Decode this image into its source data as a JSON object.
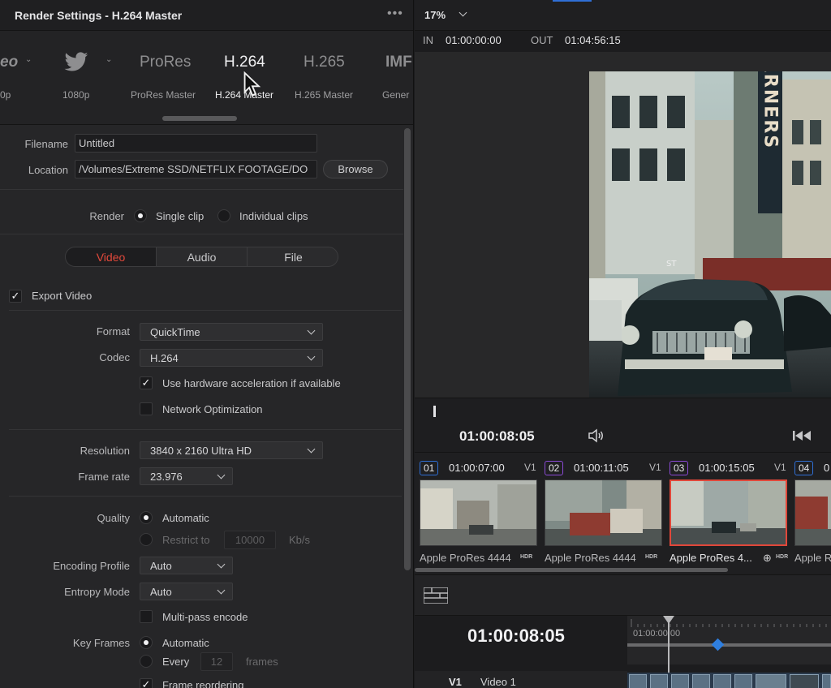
{
  "render_panel": {
    "title": "Render Settings - H.264 Master",
    "menu": "•••",
    "presets": [
      {
        "big": "eo",
        "sub": "0p"
      },
      {
        "big": "",
        "sub": "1080p",
        "icon": "twitter-icon"
      },
      {
        "big": "ProRes",
        "sub": "ProRes Master"
      },
      {
        "big": "H.264",
        "sub": "H.264 Master",
        "active": true
      },
      {
        "big": "H.265",
        "sub": "H.265 Master"
      },
      {
        "big": "IMF",
        "sub": "Gener"
      }
    ],
    "filename_label": "Filename",
    "filename_value": "Untitled",
    "location_label": "Location",
    "location_value": "/Volumes/Extreme SSD/NETFLIX FOOTAGE/DO",
    "browse": "Browse",
    "render_label": "Render",
    "render_single": "Single clip",
    "render_individual": "Individual clips",
    "tabs": [
      "Video",
      "Audio",
      "File"
    ],
    "export_video": "Export Video",
    "format_label": "Format",
    "format_value": "QuickTime",
    "codec_label": "Codec",
    "codec_value": "H.264",
    "hw_accel": "Use hardware acceleration if available",
    "network_opt": "Network Optimization",
    "resolution_label": "Resolution",
    "resolution_value": "3840 x 2160 Ultra HD",
    "framerate_label": "Frame rate",
    "framerate_value": "23.976",
    "quality_label": "Quality",
    "quality_auto": "Automatic",
    "restrict_to": "Restrict to",
    "restrict_value": "10000",
    "restrict_unit": "Kb/s",
    "encoding_label": "Encoding Profile",
    "encoding_value": "Auto",
    "entropy_label": "Entropy Mode",
    "entropy_value": "Auto",
    "multipass": "Multi-pass encode",
    "keyframes_label": "Key Frames",
    "keyframes_auto": "Automatic",
    "keyframes_every": "Every",
    "keyframes_value": "12",
    "keyframes_unit": "frames",
    "frame_reordering": "Frame reordering"
  },
  "viewer": {
    "zoom": "17%",
    "in_label": "IN",
    "in_tc": "01:00:00:00",
    "out_label": "OUT",
    "out_tc": "01:04:56:15",
    "current_tc": "01:00:08:05",
    "sign_text": "ARNERS",
    "sign_small": "ST"
  },
  "clips": [
    {
      "num": "01",
      "tc": "01:00:07:00",
      "track": "V1",
      "name": "Apple ProRes 4444",
      "tag": "HDR",
      "color": "#2f6fd6"
    },
    {
      "num": "02",
      "tc": "01:00:11:05",
      "track": "V1",
      "name": "Apple ProRes 4444",
      "tag": "HDR",
      "color": "#8b4ad6"
    },
    {
      "num": "03",
      "tc": "01:00:15:05",
      "track": "V1",
      "name": "Apple ProRes 4...",
      "tag": "HDR",
      "color": "#8b4ad6"
    },
    {
      "num": "04",
      "tc": "0",
      "track": "",
      "name": "Apple R",
      "tag": "",
      "color": "#2f6fd6"
    }
  ],
  "timeline": {
    "timecode": "01:00:08:05",
    "ruler_tc": "01:00:00:00",
    "track": "V1",
    "track_name": "Video 1"
  }
}
